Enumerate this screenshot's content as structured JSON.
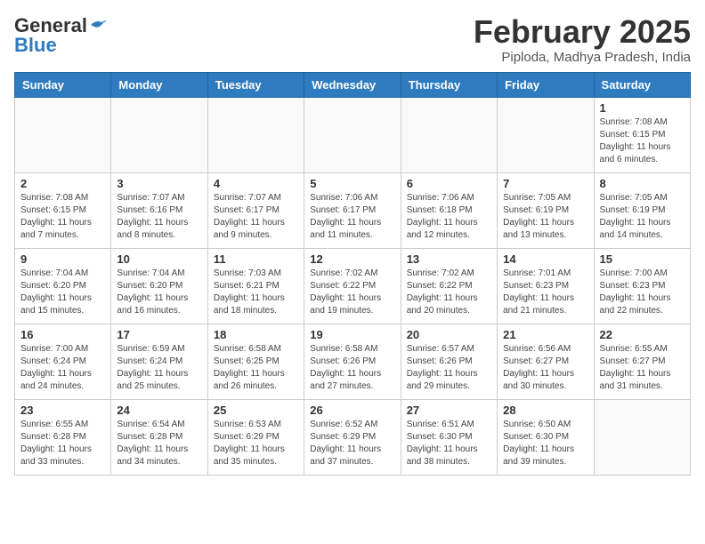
{
  "header": {
    "logo_general": "General",
    "logo_blue": "Blue",
    "month_title": "February 2025",
    "location": "Piploda, Madhya Pradesh, India"
  },
  "weekdays": [
    "Sunday",
    "Monday",
    "Tuesday",
    "Wednesday",
    "Thursday",
    "Friday",
    "Saturday"
  ],
  "weeks": [
    [
      {
        "day": "",
        "info": ""
      },
      {
        "day": "",
        "info": ""
      },
      {
        "day": "",
        "info": ""
      },
      {
        "day": "",
        "info": ""
      },
      {
        "day": "",
        "info": ""
      },
      {
        "day": "",
        "info": ""
      },
      {
        "day": "1",
        "info": "Sunrise: 7:08 AM\nSunset: 6:15 PM\nDaylight: 11 hours\nand 6 minutes."
      }
    ],
    [
      {
        "day": "2",
        "info": "Sunrise: 7:08 AM\nSunset: 6:15 PM\nDaylight: 11 hours\nand 7 minutes."
      },
      {
        "day": "3",
        "info": "Sunrise: 7:07 AM\nSunset: 6:16 PM\nDaylight: 11 hours\nand 8 minutes."
      },
      {
        "day": "4",
        "info": "Sunrise: 7:07 AM\nSunset: 6:17 PM\nDaylight: 11 hours\nand 9 minutes."
      },
      {
        "day": "5",
        "info": "Sunrise: 7:06 AM\nSunset: 6:17 PM\nDaylight: 11 hours\nand 11 minutes."
      },
      {
        "day": "6",
        "info": "Sunrise: 7:06 AM\nSunset: 6:18 PM\nDaylight: 11 hours\nand 12 minutes."
      },
      {
        "day": "7",
        "info": "Sunrise: 7:05 AM\nSunset: 6:19 PM\nDaylight: 11 hours\nand 13 minutes."
      },
      {
        "day": "8",
        "info": "Sunrise: 7:05 AM\nSunset: 6:19 PM\nDaylight: 11 hours\nand 14 minutes."
      }
    ],
    [
      {
        "day": "9",
        "info": "Sunrise: 7:04 AM\nSunset: 6:20 PM\nDaylight: 11 hours\nand 15 minutes."
      },
      {
        "day": "10",
        "info": "Sunrise: 7:04 AM\nSunset: 6:20 PM\nDaylight: 11 hours\nand 16 minutes."
      },
      {
        "day": "11",
        "info": "Sunrise: 7:03 AM\nSunset: 6:21 PM\nDaylight: 11 hours\nand 18 minutes."
      },
      {
        "day": "12",
        "info": "Sunrise: 7:02 AM\nSunset: 6:22 PM\nDaylight: 11 hours\nand 19 minutes."
      },
      {
        "day": "13",
        "info": "Sunrise: 7:02 AM\nSunset: 6:22 PM\nDaylight: 11 hours\nand 20 minutes."
      },
      {
        "day": "14",
        "info": "Sunrise: 7:01 AM\nSunset: 6:23 PM\nDaylight: 11 hours\nand 21 minutes."
      },
      {
        "day": "15",
        "info": "Sunrise: 7:00 AM\nSunset: 6:23 PM\nDaylight: 11 hours\nand 22 minutes."
      }
    ],
    [
      {
        "day": "16",
        "info": "Sunrise: 7:00 AM\nSunset: 6:24 PM\nDaylight: 11 hours\nand 24 minutes."
      },
      {
        "day": "17",
        "info": "Sunrise: 6:59 AM\nSunset: 6:24 PM\nDaylight: 11 hours\nand 25 minutes."
      },
      {
        "day": "18",
        "info": "Sunrise: 6:58 AM\nSunset: 6:25 PM\nDaylight: 11 hours\nand 26 minutes."
      },
      {
        "day": "19",
        "info": "Sunrise: 6:58 AM\nSunset: 6:26 PM\nDaylight: 11 hours\nand 27 minutes."
      },
      {
        "day": "20",
        "info": "Sunrise: 6:57 AM\nSunset: 6:26 PM\nDaylight: 11 hours\nand 29 minutes."
      },
      {
        "day": "21",
        "info": "Sunrise: 6:56 AM\nSunset: 6:27 PM\nDaylight: 11 hours\nand 30 minutes."
      },
      {
        "day": "22",
        "info": "Sunrise: 6:55 AM\nSunset: 6:27 PM\nDaylight: 11 hours\nand 31 minutes."
      }
    ],
    [
      {
        "day": "23",
        "info": "Sunrise: 6:55 AM\nSunset: 6:28 PM\nDaylight: 11 hours\nand 33 minutes."
      },
      {
        "day": "24",
        "info": "Sunrise: 6:54 AM\nSunset: 6:28 PM\nDaylight: 11 hours\nand 34 minutes."
      },
      {
        "day": "25",
        "info": "Sunrise: 6:53 AM\nSunset: 6:29 PM\nDaylight: 11 hours\nand 35 minutes."
      },
      {
        "day": "26",
        "info": "Sunrise: 6:52 AM\nSunset: 6:29 PM\nDaylight: 11 hours\nand 37 minutes."
      },
      {
        "day": "27",
        "info": "Sunrise: 6:51 AM\nSunset: 6:30 PM\nDaylight: 11 hours\nand 38 minutes."
      },
      {
        "day": "28",
        "info": "Sunrise: 6:50 AM\nSunset: 6:30 PM\nDaylight: 11 hours\nand 39 minutes."
      },
      {
        "day": "",
        "info": ""
      }
    ]
  ]
}
